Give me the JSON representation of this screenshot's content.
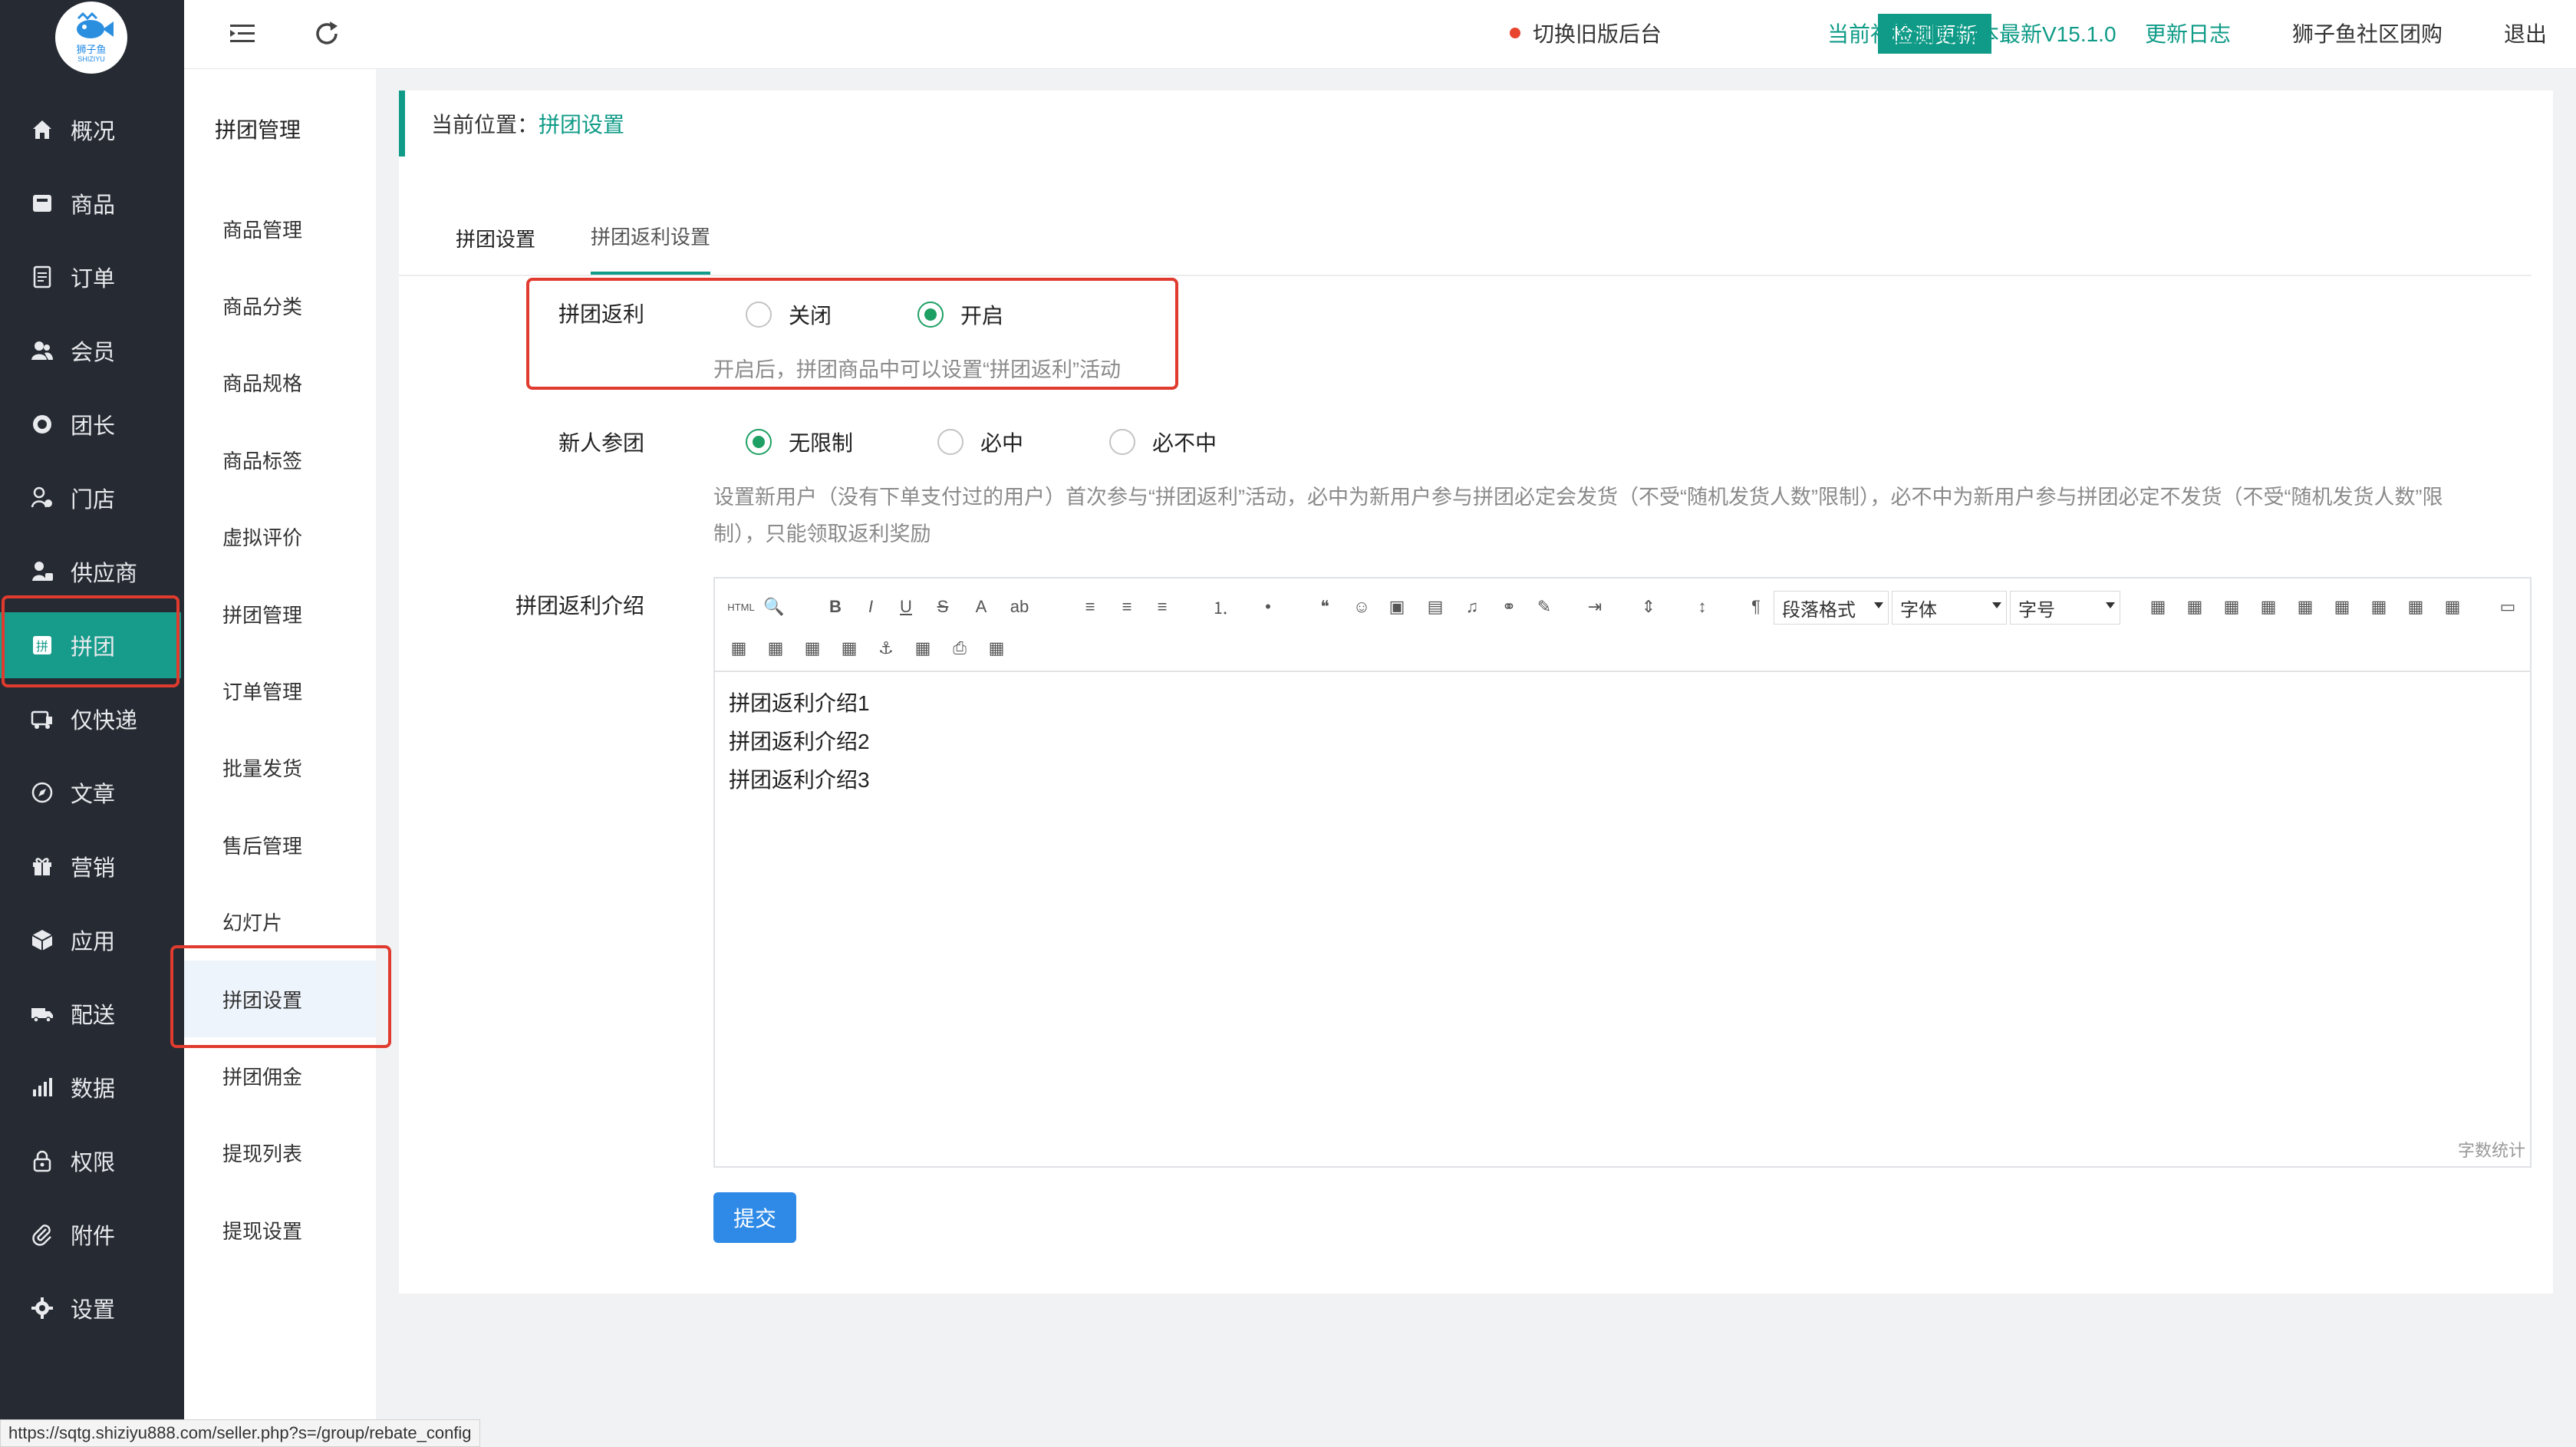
{
  "brand": {
    "logo_cn": "狮子鱼",
    "logo_en": "SHIZIYU",
    "accent": "#0f9b87",
    "highlight": "#e03b2e"
  },
  "sidebar": {
    "items": [
      {
        "label": "概况",
        "icon": "home-icon"
      },
      {
        "label": "商品",
        "icon": "box-icon"
      },
      {
        "label": "订单",
        "icon": "document-icon"
      },
      {
        "label": "会员",
        "icon": "users-icon"
      },
      {
        "label": "团长",
        "icon": "leader-icon"
      },
      {
        "label": "门店",
        "icon": "store-person-icon"
      },
      {
        "label": "供应商",
        "icon": "supplier-icon"
      },
      {
        "label": "拼团",
        "icon": "group-icon",
        "active": true
      },
      {
        "label": "仅快递",
        "icon": "express-icon"
      },
      {
        "label": "文章",
        "icon": "compass-icon"
      },
      {
        "label": "营销",
        "icon": "gift-icon"
      },
      {
        "label": "应用",
        "icon": "cube-icon"
      },
      {
        "label": "配送",
        "icon": "truck-icon"
      },
      {
        "label": "数据",
        "icon": "chart-icon"
      },
      {
        "label": "权限",
        "icon": "lock-icon"
      },
      {
        "label": "附件",
        "icon": "paperclip-icon"
      },
      {
        "label": "设置",
        "icon": "gear-icon"
      }
    ]
  },
  "submenu": {
    "title": "拼团管理",
    "items": [
      "商品管理",
      "商品分类",
      "商品规格",
      "商品标签",
      "虚拟评价",
      "拼团管理",
      "订单管理",
      "批量发货",
      "售后管理",
      "幻灯片",
      "拼团设置",
      "拼团佣金",
      "提现列表",
      "提现设置"
    ],
    "active_index": 10
  },
  "topbar": {
    "switch_old": "切换旧版后台",
    "check_update": "检测更新",
    "version_text": "当前社区团购版本最新V15.1.0",
    "changelog": "更新日志",
    "shop_name": "狮子鱼社区团购",
    "logout": "退出"
  },
  "breadcrumb": {
    "prefix": "当前位置：",
    "current": "拼团设置"
  },
  "tabs": [
    "拼团设置",
    "拼团返利设置"
  ],
  "form": {
    "rebate": {
      "label": "拼团返利",
      "options": [
        "关闭",
        "开启"
      ],
      "selected": "开启",
      "hint": "开启后，拼团商品中可以设置“拼团返利”活动"
    },
    "newbie": {
      "label": "新人参团",
      "options": [
        "无限制",
        "必中",
        "必不中"
      ],
      "selected": "无限制",
      "hint_line1": "设置新用户（没有下单支付过的用户）首次参与“拼团返利”活动，必中为新用户参与拼团必定会发货（不受“随机发货人数”限制），必不中为新用户参与拼团必定不发货（不受“随机发货人数”限",
      "hint_line2": "制），只能领取返利奖励"
    },
    "intro": {
      "label": "拼团返利介绍",
      "toolbar": {
        "paragraph": "段落格式",
        "font": "字体",
        "size": "字号",
        "html_label": "HTML"
      },
      "content": [
        "拼团返利介绍1",
        "拼团返利介绍2",
        "拼团返利介绍3"
      ],
      "word_count": "字数统计"
    },
    "submit": "提交"
  },
  "statusbar": "https://sqtg.shiziyu888.com/seller.php?s=/group/rebate_config"
}
